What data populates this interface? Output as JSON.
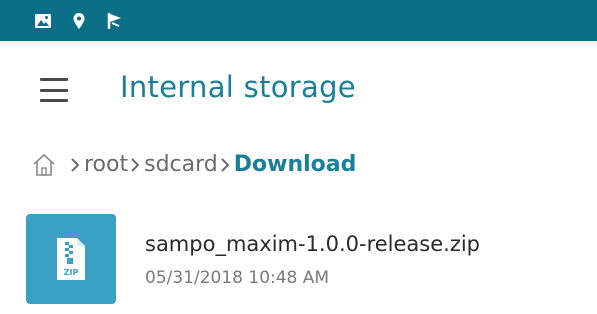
{
  "status_bar": {
    "background_color": "#0a6f86",
    "icons": [
      "image-icon",
      "location-icon",
      "flag-icon"
    ]
  },
  "app_bar": {
    "menu_icon": "hamburger-icon",
    "title": "Internal storage"
  },
  "breadcrumb": {
    "home_icon": "home-icon",
    "items": [
      {
        "label": "root"
      },
      {
        "label": "sdcard"
      },
      {
        "label": "Download"
      }
    ]
  },
  "files": [
    {
      "icon": "zip-file-icon",
      "name": "sampo_maxim-1.0.0-release.zip",
      "date": "05/31/2018 10:48 AM"
    }
  ],
  "colors": {
    "accent": "#1a7f98",
    "file_thumb": "#3aa0c4"
  }
}
